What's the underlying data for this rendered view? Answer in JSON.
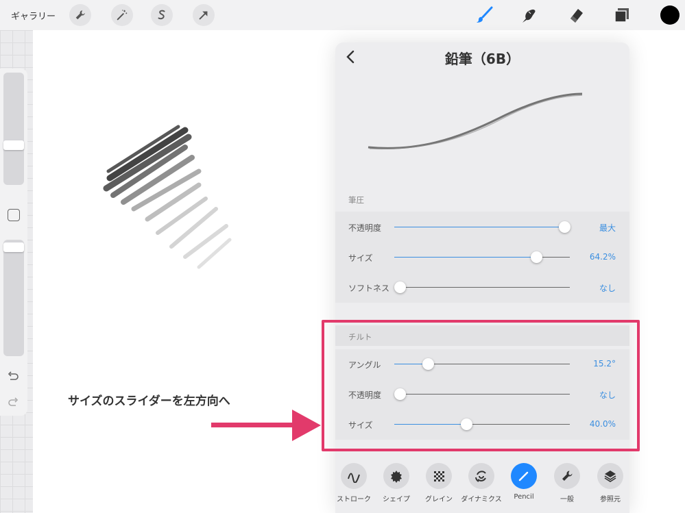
{
  "topbar": {
    "gallery_label": "ギャラリー",
    "left_tools": [
      "wrench-icon",
      "magic-wand-icon",
      "selection-icon",
      "transform-arrow-icon"
    ],
    "right_tools": [
      "brush-icon",
      "smudge-icon",
      "eraser-icon",
      "layers-icon"
    ],
    "active_tool": "brush-icon",
    "current_color": "#000000"
  },
  "sidebar": {
    "size_slider_level": 0.65,
    "opacity_slider_level": 0.95
  },
  "panel": {
    "title": "鉛筆（6B）",
    "sections": [
      {
        "label": "筆圧",
        "rows": [
          {
            "label": "不透明度",
            "value": "最大",
            "level": 0.97
          },
          {
            "label": "サイズ",
            "value": "64.2%",
            "level": 0.81
          },
          {
            "label": "ソフトネス",
            "value": "なし",
            "level": 0.03
          }
        ]
      },
      {
        "label": "チルト",
        "rows": [
          {
            "label": "アングル",
            "value": "15.2°",
            "level": 0.19
          },
          {
            "label": "不透明度",
            "value": "なし",
            "level": 0.03
          },
          {
            "label": "サイズ",
            "value": "40.0%",
            "level": 0.41
          }
        ]
      }
    ],
    "categories": [
      {
        "label": "ストローク",
        "icon": "stroke-path-icon"
      },
      {
        "label": "シェイプ",
        "icon": "shape-icon"
      },
      {
        "label": "グレイン",
        "icon": "grain-icon"
      },
      {
        "label": "ダイナミクス",
        "icon": "dynamics-icon"
      },
      {
        "label": "Pencil",
        "icon": "pencil-icon",
        "active": true
      },
      {
        "label": "一般",
        "icon": "wrench-icon"
      },
      {
        "label": "参照元",
        "icon": "layers-icon"
      }
    ]
  },
  "annotation": {
    "text": "サイズのスライダーを左方向へ",
    "highlight_color": "#e23a6b"
  },
  "colors": {
    "accent": "#3a8ee0",
    "active_category": "#1f88ff"
  }
}
